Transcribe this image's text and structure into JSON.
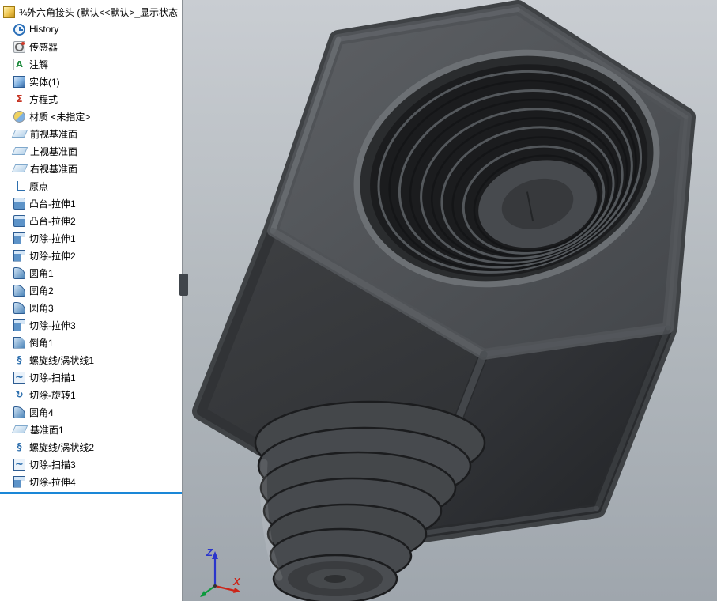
{
  "sidebar": {
    "items": [
      {
        "label": "¾外六角接头 (默认<<默认>_显示状态",
        "icon": "part-icon"
      },
      {
        "label": "History",
        "icon": "history-icon"
      },
      {
        "label": "传感器",
        "icon": "sensors-icon"
      },
      {
        "label": "注解",
        "icon": "annotations-icon"
      },
      {
        "label": "实体(1)",
        "icon": "solid-bodies-icon"
      },
      {
        "label": "方程式",
        "icon": "equations-icon"
      },
      {
        "label": "材质 <未指定>",
        "icon": "material-icon"
      },
      {
        "label": "前视基准面",
        "icon": "plane-icon"
      },
      {
        "label": "上视基准面",
        "icon": "plane-icon"
      },
      {
        "label": "右视基准面",
        "icon": "plane-icon"
      },
      {
        "label": "原点",
        "icon": "origin-icon"
      },
      {
        "label": "凸台-拉伸1",
        "icon": "boss-extrude-icon"
      },
      {
        "label": "凸台-拉伸2",
        "icon": "boss-extrude-icon"
      },
      {
        "label": "切除-拉伸1",
        "icon": "cut-extrude-icon"
      },
      {
        "label": "切除-拉伸2",
        "icon": "cut-extrude-icon"
      },
      {
        "label": "圆角1",
        "icon": "fillet-icon"
      },
      {
        "label": "圆角2",
        "icon": "fillet-icon"
      },
      {
        "label": "圆角3",
        "icon": "fillet-icon"
      },
      {
        "label": "切除-拉伸3",
        "icon": "cut-extrude-icon"
      },
      {
        "label": "倒角1",
        "icon": "chamfer-icon"
      },
      {
        "label": "螺旋线/涡状线1",
        "icon": "helix-icon"
      },
      {
        "label": "切除-扫描1",
        "icon": "cut-sweep-icon"
      },
      {
        "label": "切除-旋转1",
        "icon": "cut-revolve-icon"
      },
      {
        "label": "圆角4",
        "icon": "fillet-icon"
      },
      {
        "label": "基准面1",
        "icon": "plane-icon"
      },
      {
        "label": "螺旋线/涡状线2",
        "icon": "helix-icon"
      },
      {
        "label": "切除-扫描3",
        "icon": "cut-sweep-icon"
      },
      {
        "label": "切除-拉伸4",
        "icon": "cut-extrude-icon"
      }
    ],
    "rollback_color": "#1a87d7"
  },
  "viewport": {
    "triad": {
      "z_label": "Z",
      "x_label": "X"
    },
    "colors": {
      "axis_x": "#cc2418",
      "axis_y": "#0c9a3c",
      "axis_z": "#2a35cc",
      "model_body": "#3f4245",
      "background_top": "#c9cdd2",
      "background_bottom": "#9fa6ad"
    }
  }
}
